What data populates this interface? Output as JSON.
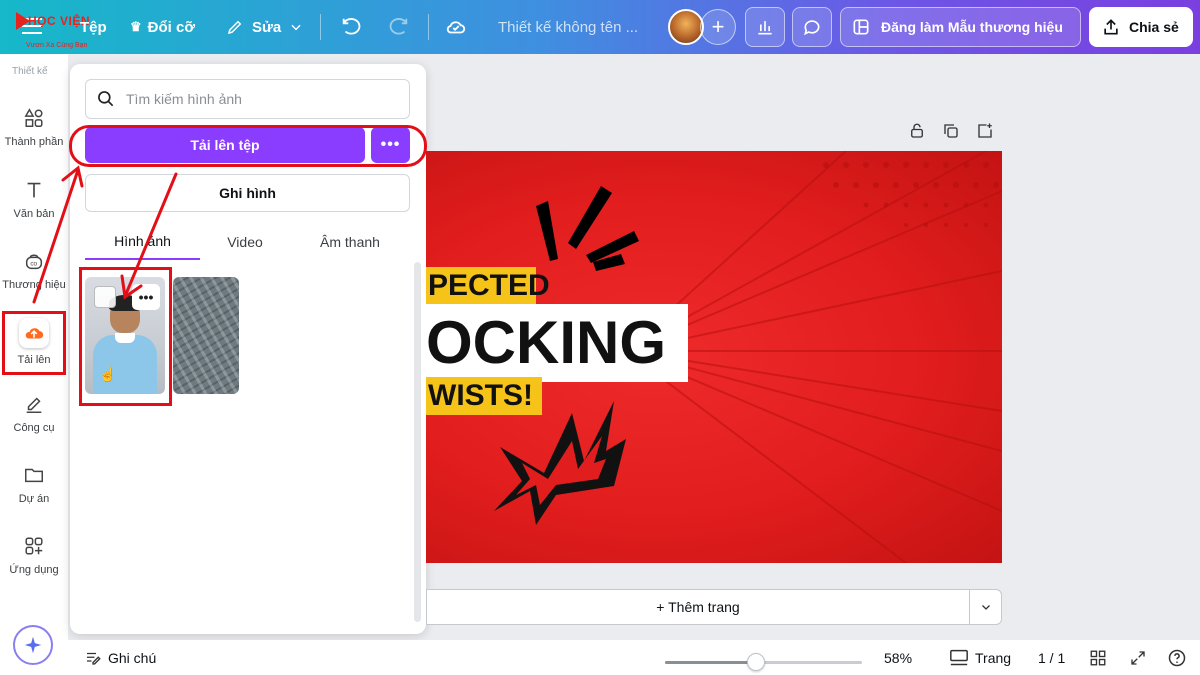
{
  "logo": {
    "line1": "HỌC VIỆN",
    "line2": "Vươn Xa Cùng Bạn"
  },
  "topbar": {
    "menu_label": "Tệp",
    "resize_label": "Đổi cỡ",
    "edit_label": "Sửa",
    "doc_title": "Thiết kế không tên ...",
    "brand_button": "Đăng làm Mẫu thương hiệu",
    "share_button": "Chia sẻ"
  },
  "rail": {
    "top_label": "Thiết kế",
    "items": [
      {
        "label": "Thành phần",
        "icon": "elements-icon"
      },
      {
        "label": "Văn bản",
        "icon": "text-icon"
      },
      {
        "label": "Thương hiệu",
        "icon": "brand-icon"
      },
      {
        "label": "Tải lên",
        "icon": "upload-cloud-icon"
      },
      {
        "label": "Công cụ",
        "icon": "draw-tool-icon"
      },
      {
        "label": "Dự án",
        "icon": "folder-icon"
      },
      {
        "label": "Ứng dụng",
        "icon": "apps-icon"
      }
    ]
  },
  "panel": {
    "search_placeholder": "Tìm kiếm hình ảnh",
    "upload_button": "Tải lên tệp",
    "more_button": "•••",
    "record_button": "Ghi hình",
    "tabs": [
      "Hình ảnh",
      "Video",
      "Âm thanh"
    ],
    "active_tab": "Hình ảnh",
    "thumb_more": "•••"
  },
  "canvas": {
    "line1": "PECTED",
    "line2": "OCKING",
    "line3": "WISTS!",
    "add_page": "+ Thêm trang"
  },
  "bottom": {
    "notes": "Ghi chú",
    "zoom": "58%",
    "zoom_fraction": 0.46,
    "pages_label": "Trang",
    "page_count": "1 / 1"
  },
  "colors": {
    "accent": "#8b3dff",
    "annotation": "#e30f17",
    "canvas_red": "#e11d1d",
    "label_yellow": "#f6c418"
  }
}
